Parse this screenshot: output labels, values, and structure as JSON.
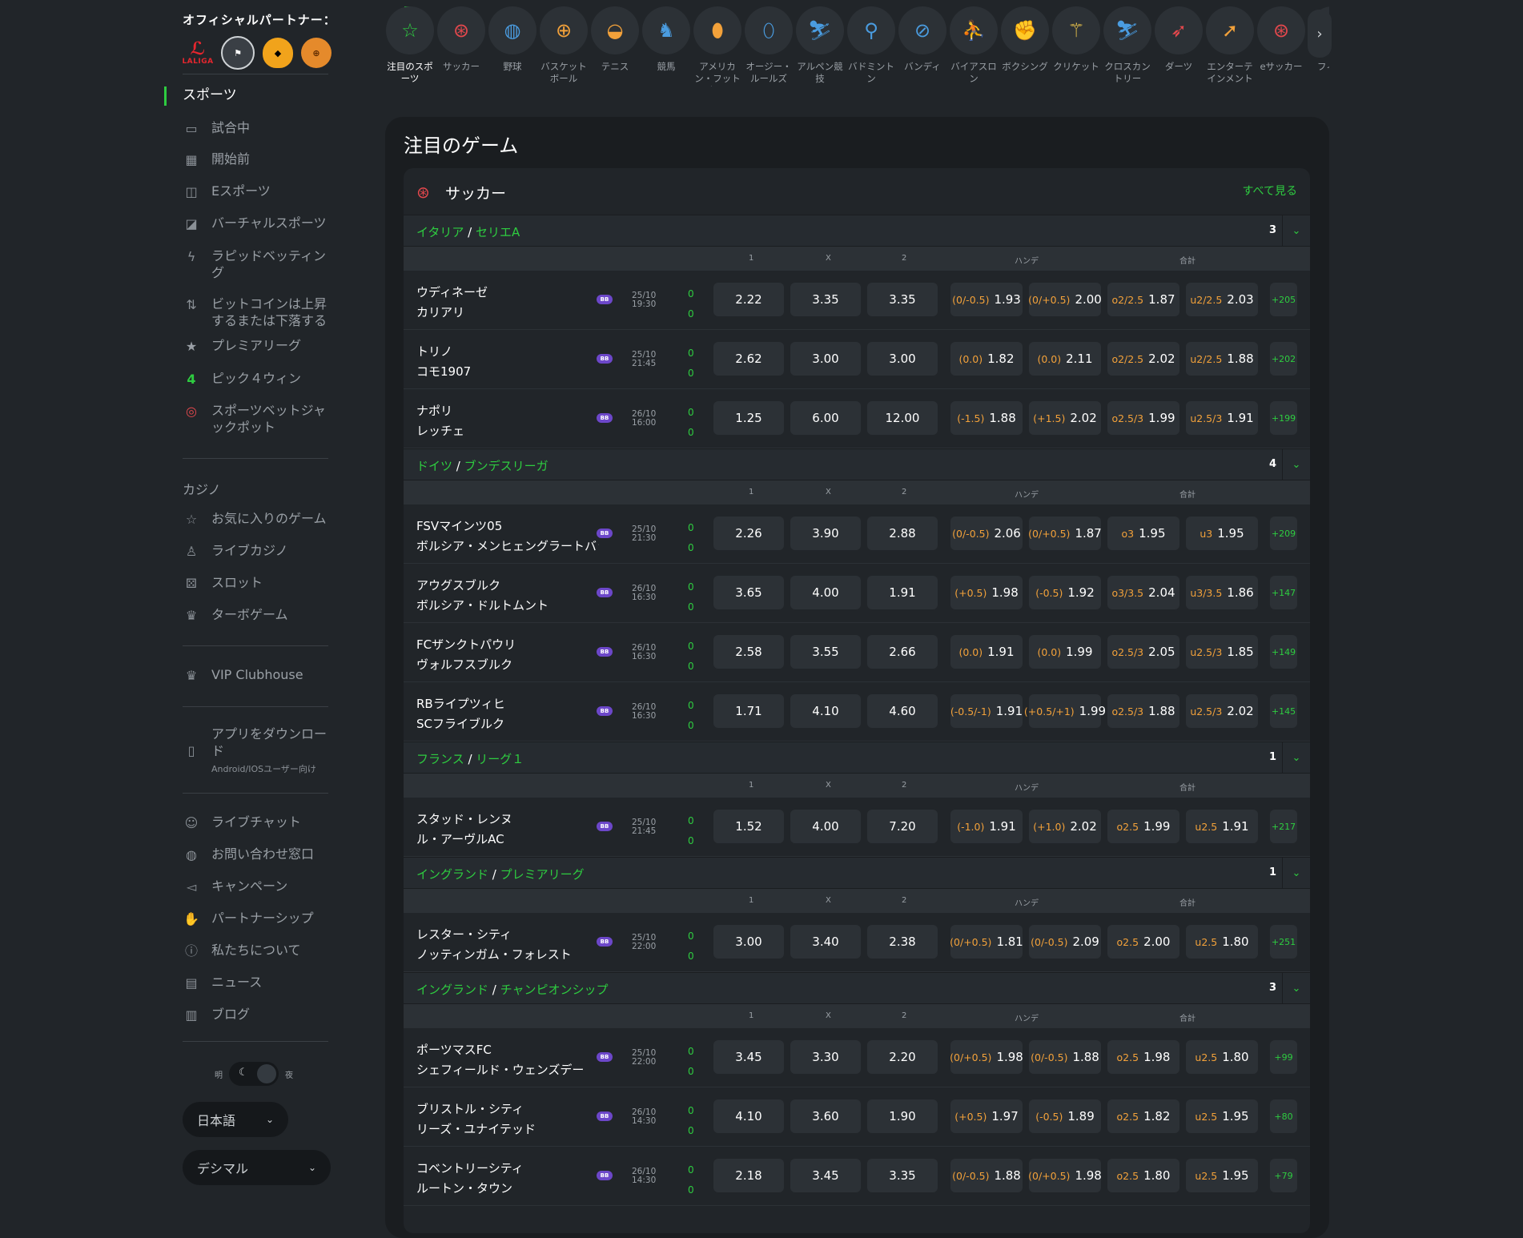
{
  "partners": {
    "title": "オフィシャルパートナー：",
    "logos": [
      {
        "name": "laliga",
        "text": "LALIGA"
      },
      {
        "name": "newcastle",
        "text": ""
      },
      {
        "name": "hull-city",
        "text": ""
      },
      {
        "name": "basketball-club",
        "text": ""
      }
    ]
  },
  "sidebar": {
    "sports_label": "スポーツ",
    "sports_items": [
      {
        "label": "試合中",
        "icon": "monitor-icon"
      },
      {
        "label": "開始前",
        "icon": "calendar-icon"
      },
      {
        "label": "Eスポーツ",
        "icon": "gamepad-icon"
      },
      {
        "label": "バーチャルスポーツ",
        "icon": "vr-icon"
      },
      {
        "label": "ラピッドベッティング",
        "icon": "lightning-icon"
      },
      {
        "label": "ビットコインは上昇するまたは下落する",
        "icon": "updown-icon"
      },
      {
        "label": "プレミアリーグ",
        "icon": "star-icon"
      },
      {
        "label": "ピック４ウィン",
        "icon": "four-icon"
      },
      {
        "label": "スポーツベットジャックポット",
        "icon": "target-icon"
      }
    ],
    "casino_label": "カジノ",
    "casino_items": [
      {
        "label": "お気に入りのゲーム",
        "icon": "star-outline-icon"
      },
      {
        "label": "ライブカジノ",
        "icon": "dealer-icon"
      },
      {
        "label": "スロット",
        "icon": "slot-icon"
      },
      {
        "label": "ターボゲーム",
        "icon": "crown-icon"
      }
    ],
    "vip": {
      "label": "VIP Clubhouse",
      "icon": "crown-icon"
    },
    "app": {
      "label": "アプリをダウンロード",
      "sub": "Android/IOSユーザー向け",
      "icon": "phone-icon"
    },
    "info_items": [
      {
        "label": "ライブチャット",
        "icon": "chat-icon"
      },
      {
        "label": "お問い合わせ窓口",
        "icon": "lifebuoy-icon"
      },
      {
        "label": "キャンペーン",
        "icon": "megaphone-icon"
      },
      {
        "label": "パートナーシップ",
        "icon": "handshake-icon"
      },
      {
        "label": "私たちについて",
        "icon": "info-icon"
      },
      {
        "label": "ニュース",
        "icon": "news-icon"
      },
      {
        "label": "ブログ",
        "icon": "blog-icon"
      }
    ],
    "theme": {
      "day": "明",
      "night": "夜"
    },
    "language": "日本語",
    "odds_format": "デシマル"
  },
  "sports": [
    {
      "label": "注目のスポーツ",
      "icon": "star-icon",
      "active": true
    },
    {
      "label": "サッカー",
      "icon": "soccer-icon"
    },
    {
      "label": "野球",
      "icon": "baseball-icon"
    },
    {
      "label": "バスケットボール",
      "icon": "basketball-icon"
    },
    {
      "label": "テニス",
      "icon": "tennis-icon"
    },
    {
      "label": "競馬",
      "icon": "horse-icon"
    },
    {
      "label": "アメリカン・フットボール",
      "icon": "american-football-icon"
    },
    {
      "label": "オージー・ルールズ",
      "icon": "aussie-rules-icon"
    },
    {
      "label": "アルペン競技",
      "icon": "ski-icon"
    },
    {
      "label": "バドミントン",
      "icon": "badminton-icon"
    },
    {
      "label": "バンディ",
      "icon": "bandy-icon"
    },
    {
      "label": "バイアスロン",
      "icon": "biathlon-icon"
    },
    {
      "label": "ボクシング",
      "icon": "boxing-icon"
    },
    {
      "label": "クリケット",
      "icon": "cricket-icon"
    },
    {
      "label": "クロスカントリー",
      "icon": "cross-country-icon"
    },
    {
      "label": "ダーツ",
      "icon": "darts-icon"
    },
    {
      "label": "エンターテインメント",
      "icon": "rocket-icon"
    },
    {
      "label": "eサッカー",
      "icon": "esoccer-icon"
    },
    {
      "label": "フィ ホ",
      "icon": "hockey-icon"
    }
  ],
  "main": {
    "title": "注目のゲーム",
    "sport_name": "サッカー",
    "see_all": "すべて見る",
    "headers": {
      "c1": "1",
      "cx": "X",
      "c2": "2",
      "handi": "ハンデ",
      "total": "合計"
    },
    "bb_label": "BB",
    "leagues": [
      {
        "country": "イタリア",
        "name": "セリエA",
        "count": "3",
        "matches": [
          {
            "home": "ウディネーゼ",
            "away": "カリアリ",
            "date": "25/10",
            "time": "19:30",
            "s1": "0",
            "s2": "0",
            "o1": "2.22",
            "ox": "3.35",
            "o2": "3.35",
            "h1": "(0/-0.5)",
            "h1o": "1.93",
            "h2": "(0/+0.5)",
            "h2o": "2.00",
            "t1": "o2/2.5",
            "t1o": "1.87",
            "t2": "u2/2.5",
            "t2o": "2.03",
            "more": "+205"
          },
          {
            "home": "トリノ",
            "away": "コモ1907",
            "date": "25/10",
            "time": "21:45",
            "s1": "0",
            "s2": "0",
            "o1": "2.62",
            "ox": "3.00",
            "o2": "3.00",
            "h1": "(0.0)",
            "h1o": "1.82",
            "h2": "(0.0)",
            "h2o": "2.11",
            "t1": "o2/2.5",
            "t1o": "2.02",
            "t2": "u2/2.5",
            "t2o": "1.88",
            "more": "+202"
          },
          {
            "home": "ナポリ",
            "away": "レッチェ",
            "date": "26/10",
            "time": "16:00",
            "s1": "0",
            "s2": "0",
            "o1": "1.25",
            "ox": "6.00",
            "o2": "12.00",
            "h1": "(-1.5)",
            "h1o": "1.88",
            "h2": "(+1.5)",
            "h2o": "2.02",
            "t1": "o2.5/3",
            "t1o": "1.99",
            "t2": "u2.5/3",
            "t2o": "1.91",
            "more": "+199"
          }
        ]
      },
      {
        "country": "ドイツ",
        "name": "ブンデスリーガ",
        "count": "4",
        "matches": [
          {
            "home": "FSVマインツ05",
            "away": "ボルシア・メンヒェングラートバッハ",
            "date": "25/10",
            "time": "21:30",
            "s1": "0",
            "s2": "0",
            "o1": "2.26",
            "ox": "3.90",
            "o2": "2.88",
            "h1": "(0/-0.5)",
            "h1o": "2.06",
            "h2": "(0/+0.5)",
            "h2o": "1.87",
            "t1": "o3",
            "t1o": "1.95",
            "t2": "u3",
            "t2o": "1.95",
            "more": "+209"
          },
          {
            "home": "アウグスブルク",
            "away": "ボルシア・ドルトムント",
            "date": "26/10",
            "time": "16:30",
            "s1": "0",
            "s2": "0",
            "o1": "3.65",
            "ox": "4.00",
            "o2": "1.91",
            "h1": "(+0.5)",
            "h1o": "1.98",
            "h2": "(-0.5)",
            "h2o": "1.92",
            "t1": "o3/3.5",
            "t1o": "2.04",
            "t2": "u3/3.5",
            "t2o": "1.86",
            "more": "+147"
          },
          {
            "home": "FCザンクトパウリ",
            "away": "ヴォルフスブルク",
            "date": "26/10",
            "time": "16:30",
            "s1": "0",
            "s2": "0",
            "o1": "2.58",
            "ox": "3.55",
            "o2": "2.66",
            "h1": "(0.0)",
            "h1o": "1.91",
            "h2": "(0.0)",
            "h2o": "1.99",
            "t1": "o2.5/3",
            "t1o": "2.05",
            "t2": "u2.5/3",
            "t2o": "1.85",
            "more": "+149"
          },
          {
            "home": "RBライプツィヒ",
            "away": "SCフライブルク",
            "date": "26/10",
            "time": "16:30",
            "s1": "0",
            "s2": "0",
            "o1": "1.71",
            "ox": "4.10",
            "o2": "4.60",
            "h1": "(-0.5/-1)",
            "h1o": "1.91",
            "h2": "(+0.5/+1)",
            "h2o": "1.99",
            "t1": "o2.5/3",
            "t1o": "1.88",
            "t2": "u2.5/3",
            "t2o": "2.02",
            "more": "+145"
          }
        ]
      },
      {
        "country": "フランス",
        "name": "リーグ１",
        "count": "1",
        "matches": [
          {
            "home": "スタッド・レンヌ",
            "away": "ル・アーヴルAC",
            "date": "25/10",
            "time": "21:45",
            "s1": "0",
            "s2": "0",
            "o1": "1.52",
            "ox": "4.00",
            "o2": "7.20",
            "h1": "(-1.0)",
            "h1o": "1.91",
            "h2": "(+1.0)",
            "h2o": "2.02",
            "t1": "o2.5",
            "t1o": "1.99",
            "t2": "u2.5",
            "t2o": "1.91",
            "more": "+217"
          }
        ]
      },
      {
        "country": "イングランド",
        "name": "プレミアリーグ",
        "count": "1",
        "matches": [
          {
            "home": "レスター・シティ",
            "away": "ノッティンガム・フォレスト",
            "date": "25/10",
            "time": "22:00",
            "s1": "0",
            "s2": "0",
            "o1": "3.00",
            "ox": "3.40",
            "o2": "2.38",
            "h1": "(0/+0.5)",
            "h1o": "1.81",
            "h2": "(0/-0.5)",
            "h2o": "2.09",
            "t1": "o2.5",
            "t1o": "2.00",
            "t2": "u2.5",
            "t2o": "1.80",
            "more": "+251"
          }
        ]
      },
      {
        "country": "イングランド",
        "name": "チャンピオンシップ",
        "count": "3",
        "matches": [
          {
            "home": "ポーツマスFC",
            "away": "シェフィールド・ウェンズデー",
            "date": "25/10",
            "time": "22:00",
            "s1": "0",
            "s2": "0",
            "o1": "3.45",
            "ox": "3.30",
            "o2": "2.20",
            "h1": "(0/+0.5)",
            "h1o": "1.98",
            "h2": "(0/-0.5)",
            "h2o": "1.88",
            "t1": "o2.5",
            "t1o": "1.98",
            "t2": "u2.5",
            "t2o": "1.80",
            "more": "+99"
          },
          {
            "home": "ブリストル・シティ",
            "away": "リーズ・ユナイテッド",
            "date": "26/10",
            "time": "14:30",
            "s1": "0",
            "s2": "0",
            "o1": "4.10",
            "ox": "3.60",
            "o2": "1.90",
            "h1": "(+0.5)",
            "h1o": "1.97",
            "h2": "(-0.5)",
            "h2o": "1.89",
            "t1": "o2.5",
            "t1o": "1.82",
            "t2": "u2.5",
            "t2o": "1.95",
            "more": "+80"
          },
          {
            "home": "コベントリーシティ",
            "away": "ルートン・タウン",
            "date": "26/10",
            "time": "14:30",
            "s1": "0",
            "s2": "0",
            "o1": "2.18",
            "ox": "3.45",
            "o2": "3.35",
            "h1": "(0/-0.5)",
            "h1o": "1.88",
            "h2": "(0/+0.5)",
            "h2o": "1.98",
            "t1": "o2.5",
            "t1o": "1.80",
            "t2": "u2.5",
            "t2o": "1.95",
            "more": "+79"
          }
        ]
      }
    ]
  }
}
